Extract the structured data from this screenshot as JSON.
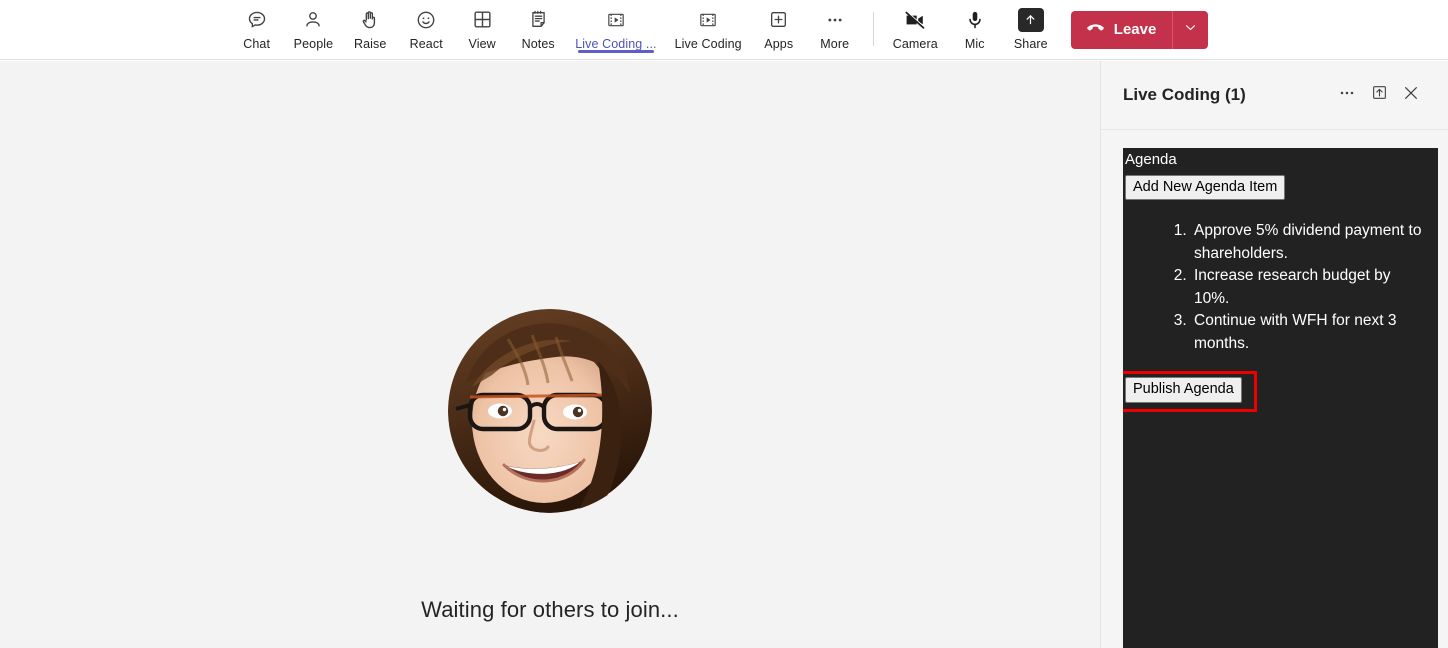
{
  "toolbar": {
    "items": [
      {
        "label": "Chat",
        "icon": "chat-icon",
        "active": false
      },
      {
        "label": "People",
        "icon": "people-icon",
        "active": false
      },
      {
        "label": "Raise",
        "icon": "raise-hand-icon",
        "active": false
      },
      {
        "label": "React",
        "icon": "react-emoji-icon",
        "active": false
      },
      {
        "label": "View",
        "icon": "view-grid-icon",
        "active": false
      },
      {
        "label": "Notes",
        "icon": "notes-icon",
        "active": false
      },
      {
        "label": "Live Coding ...",
        "icon": "live-coding-icon",
        "active": true
      },
      {
        "label": "Live Coding",
        "icon": "live-coding-icon",
        "active": false
      },
      {
        "label": "Apps",
        "icon": "apps-plus-icon",
        "active": false
      },
      {
        "label": "More",
        "icon": "more-ellipsis-icon",
        "active": false
      }
    ],
    "device_items": [
      {
        "label": "Camera",
        "icon": "camera-off-icon"
      },
      {
        "label": "Mic",
        "icon": "microphone-icon"
      },
      {
        "label": "Share",
        "icon": "share-screen-icon"
      }
    ],
    "leave_label": "Leave",
    "leave_icon": "hangup-phone-icon",
    "leave_caret_icon": "chevron-down-icon",
    "leave_color": "#c4314b",
    "active_underline_color": "#5b5fc7"
  },
  "stage": {
    "avatar_name": "participant-avatar",
    "waiting_text": "Waiting for others to join..."
  },
  "panel": {
    "title": "Live Coding (1)",
    "actions": [
      {
        "name": "more-options-icon",
        "glyph": "more-ellipsis-icon"
      },
      {
        "name": "popout-icon",
        "glyph": "open-in-new-icon"
      },
      {
        "name": "close-icon",
        "glyph": "close-x-icon"
      }
    ],
    "app": {
      "heading": "Agenda",
      "add_button_label": "Add New Agenda Item",
      "agenda_items": [
        "Approve 5% dividend payment to shareholders.",
        "Increase research budget by 10%.",
        "Continue with WFH for next 3 months."
      ],
      "publish_button_label": "Publish Agenda",
      "highlight_color": "#ee0000",
      "background_color": "#222222"
    }
  }
}
